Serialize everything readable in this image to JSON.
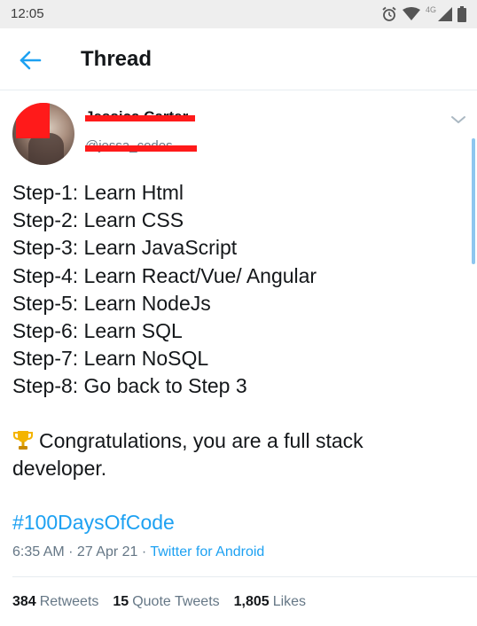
{
  "status_bar": {
    "time": "12:05",
    "network": "4G",
    "icons": [
      "alarm-icon",
      "wifi-icon",
      "signal-icon",
      "battery-icon"
    ]
  },
  "app_bar": {
    "title": "Thread",
    "back_icon": "arrow-left-icon",
    "accent": "#1da1f2"
  },
  "tweet": {
    "author": {
      "name": "Jessica Carter",
      "handle": "@jessa_codes"
    },
    "steps": [
      "Step-1: Learn Html",
      "Step-2: Learn CSS",
      "Step-3: Learn JavaScript",
      "Step-4: Learn React/Vue/ Angular",
      "Step-5: Learn NodeJs",
      "Step-6: Learn SQL",
      "Step-7: Learn NoSQL",
      "Step-8: Go back to Step 3"
    ],
    "congrats_text": "Congratulations, you are a full stack developer.",
    "congrats_icon": "trophy-icon",
    "hashtag": "#100DaysOfCode",
    "timestamp": "6:35 AM · 27 Apr 21 · ",
    "source": "Twitter for Android",
    "stats": {
      "retweets_count": "384",
      "retweets_label": "Retweets",
      "quotes_count": "15",
      "quotes_label": "Quote Tweets",
      "likes_count": "1,805",
      "likes_label": "Likes"
    }
  }
}
